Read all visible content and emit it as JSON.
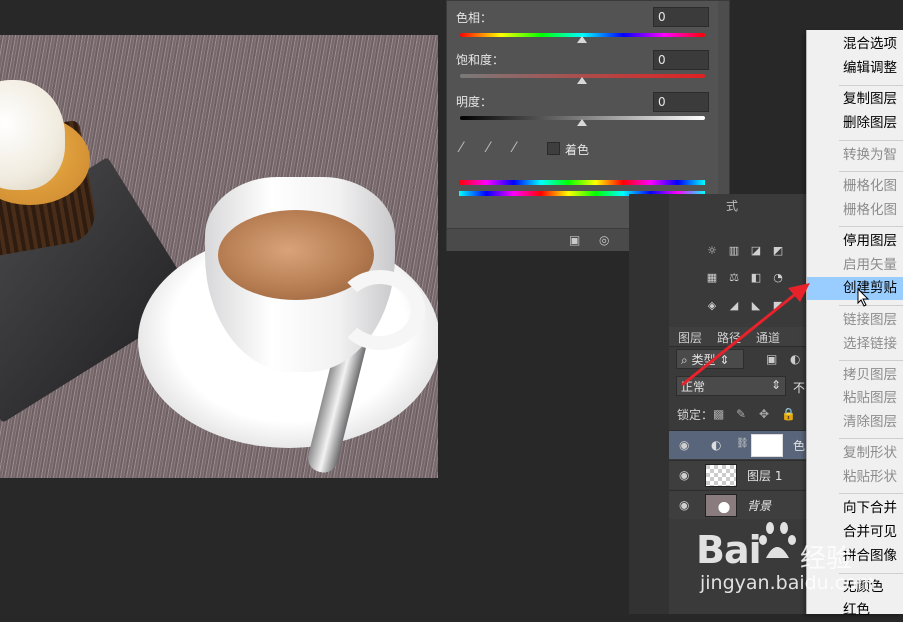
{
  "hue_panel": {
    "hue_label": "色相：",
    "hue_value": "0",
    "saturation_label": "饱和度：",
    "saturation_value": "0",
    "lightness_label": "明度：",
    "lightness_value": "0",
    "colorize_label": "着色"
  },
  "dock": {
    "tab_partial": "式",
    "layers_tab": "图层",
    "paths_tab": "路径",
    "channels_tab": "通道",
    "filter_kind": "类型",
    "blend_mode": "正常",
    "opacity_partial": "不",
    "lock_label": "锁定：",
    "layers": [
      {
        "name": "色"
      },
      {
        "name": "图层 1"
      },
      {
        "name": "背景"
      }
    ]
  },
  "context_menu": {
    "items": [
      {
        "label": "混合选项",
        "disabled": false
      },
      {
        "label": "编辑调整",
        "disabled": false
      },
      {
        "label": "复制图层",
        "disabled": false
      },
      {
        "label": "删除图层",
        "disabled": false
      },
      {
        "label": "转换为智",
        "disabled": true
      },
      {
        "label": "栅格化图",
        "disabled": true
      },
      {
        "label": "栅格化图",
        "disabled": true
      },
      {
        "label": "停用图层",
        "disabled": false
      },
      {
        "label": "启用矢量",
        "disabled": true
      },
      {
        "label": "创建剪贴",
        "disabled": false,
        "highlighted": true
      },
      {
        "label": "链接图层",
        "disabled": true
      },
      {
        "label": "选择链接",
        "disabled": true
      },
      {
        "label": "拷贝图层",
        "disabled": true
      },
      {
        "label": "粘贴图层",
        "disabled": true
      },
      {
        "label": "清除图层",
        "disabled": true
      },
      {
        "label": "复制形状",
        "disabled": true
      },
      {
        "label": "粘贴形状",
        "disabled": true
      },
      {
        "label": "向下合并",
        "disabled": false
      },
      {
        "label": "合并可见",
        "disabled": false
      },
      {
        "label": "拼合图像",
        "disabled": false
      },
      {
        "label": "无颜色",
        "disabled": false
      },
      {
        "label": "红色",
        "disabled": false
      }
    ]
  },
  "watermark": {
    "brand": "Bai",
    "brand2": "经验",
    "url": "jingyan.baidu.com"
  },
  "colors": {
    "menu_highlight": "#99ccff",
    "arrow": "#e8222b"
  }
}
